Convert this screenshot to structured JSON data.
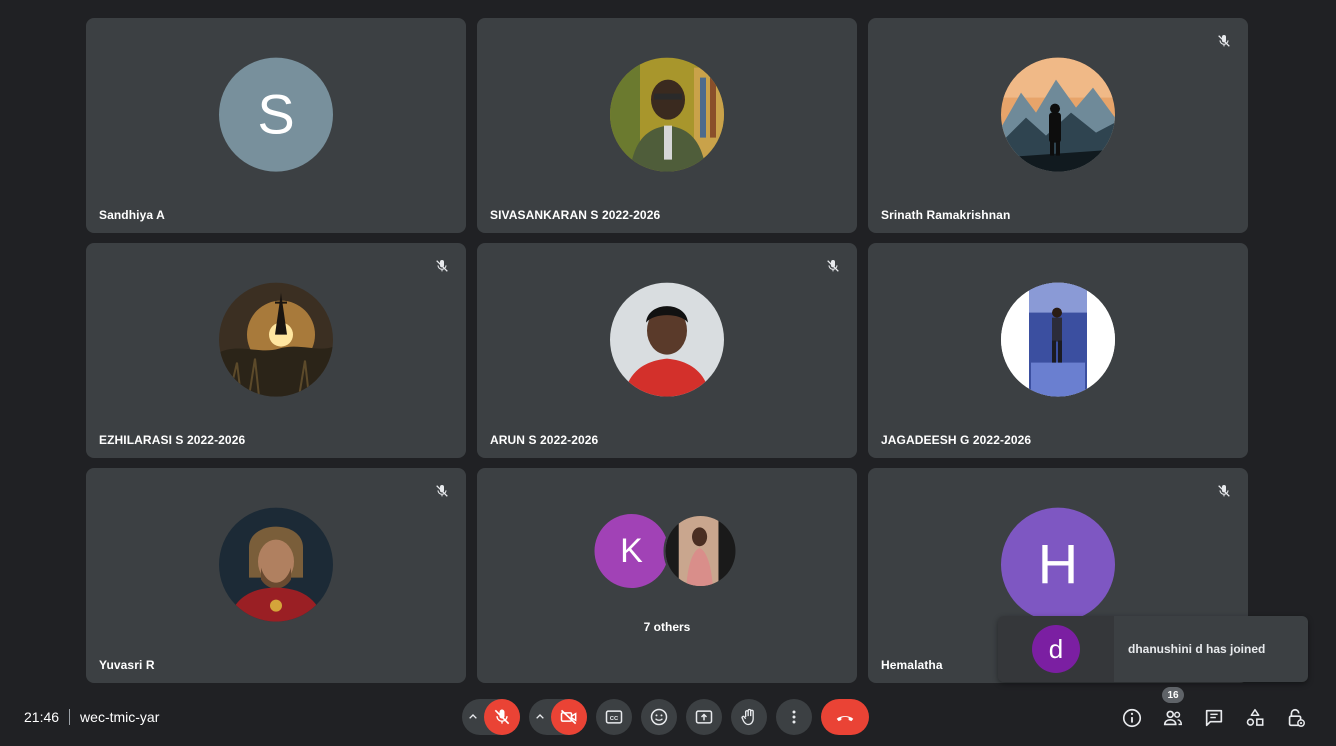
{
  "participants": [
    {
      "name": "Sandhiya A",
      "avatar_letter": "S",
      "avatar_color": "#78909c",
      "muted": false
    },
    {
      "name": "SIVASANKARAN S 2022-2026",
      "avatar_type": "photo-person-library",
      "muted": false
    },
    {
      "name": "Srinath Ramakrishnan",
      "avatar_type": "photo-mountain-hiker",
      "muted": true
    },
    {
      "name": "EZHILARASI S 2022-2026",
      "avatar_type": "photo-sunset-tower",
      "muted": true
    },
    {
      "name": "ARUN S 2022-2026",
      "avatar_type": "photo-person-red-shirt",
      "muted": true
    },
    {
      "name": "JAGADEESH G 2022-2026",
      "avatar_type": "photo-person-stage",
      "muted": false
    },
    {
      "name": "Yuvasri R",
      "avatar_type": "photo-hero-character",
      "muted": true
    },
    {
      "others_label": "7 others",
      "avatar_letter": "K",
      "avatar_color": "#a142b6",
      "muted": false
    },
    {
      "name": "Hemalatha",
      "avatar_letter": "H",
      "avatar_color": "#7e57c2",
      "muted": true
    }
  ],
  "toast": {
    "avatar_letter": "d",
    "avatar_color": "#7b1fa2",
    "text": "dhanushini d has joined"
  },
  "meeting": {
    "time": "21:46",
    "code": "wec-tmic-yar"
  },
  "controls": {
    "icons": [
      "chevron-up-icon",
      "mic-off-icon",
      "chevron-up-icon",
      "camera-off-icon",
      "captions-icon",
      "emoji-icon",
      "present-icon",
      "raise-hand-icon",
      "more-options-icon",
      "end-call-icon"
    ],
    "end_color": "#ea4335"
  },
  "right_panel": {
    "people_count": "16",
    "icons": [
      "info-icon",
      "people-icon",
      "chat-icon",
      "activities-icon",
      "host-controls-icon"
    ]
  }
}
